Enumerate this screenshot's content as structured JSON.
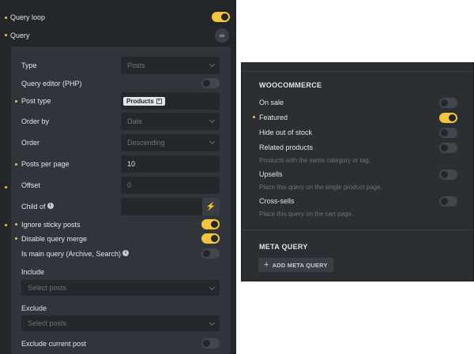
{
  "top": {
    "query_loop_label": "Query loop",
    "query_label": "Query"
  },
  "query": {
    "type_label": "Type",
    "type_value": "Posts",
    "editor_label": "Query editor (PHP)",
    "post_type_label": "Post type",
    "post_type_tag": "Products",
    "order_by_label": "Order by",
    "order_by_value": "Date",
    "order_label": "Order",
    "order_value": "Descending",
    "per_page_label": "Posts per page",
    "per_page_value": "10",
    "offset_label": "Offset",
    "offset_placeholder": "0",
    "child_of_label": "Child of",
    "ignore_sticky_label": "Ignore sticky posts",
    "disable_merge_label": "Disable query merge",
    "main_query_label": "Is main query (Archive, Search)",
    "include_label": "Include",
    "include_placeholder": "Select posts",
    "exclude_label": "Exclude",
    "exclude_placeholder": "Select posts",
    "exclude_current_label": "Exclude current post"
  },
  "woo": {
    "title": "WOOCOMMERCE",
    "on_sale_label": "On sale",
    "featured_label": "Featured",
    "hide_oos_label": "Hide out of stock",
    "related_label": "Related products",
    "related_hint": "Products with the same category or tag.",
    "upsells_label": "Upsells",
    "upsells_hint": "Place this query on the single product page.",
    "cross_label": "Cross-sells",
    "cross_hint": "Place this query on the cart page."
  },
  "meta": {
    "title": "META QUERY",
    "add_label": "ADD META QUERY"
  },
  "toggles": {
    "query_loop": true,
    "query_editor": false,
    "ignore_sticky": true,
    "disable_merge": true,
    "main_query": false,
    "exclude_current": false,
    "on_sale": false,
    "featured": true,
    "hide_oos": false,
    "related": false,
    "upsells": false,
    "cross_sells": false
  },
  "colors": {
    "accent": "#f2c53d",
    "panel_bg": "#23262b",
    "inner_bg": "#30343b"
  }
}
